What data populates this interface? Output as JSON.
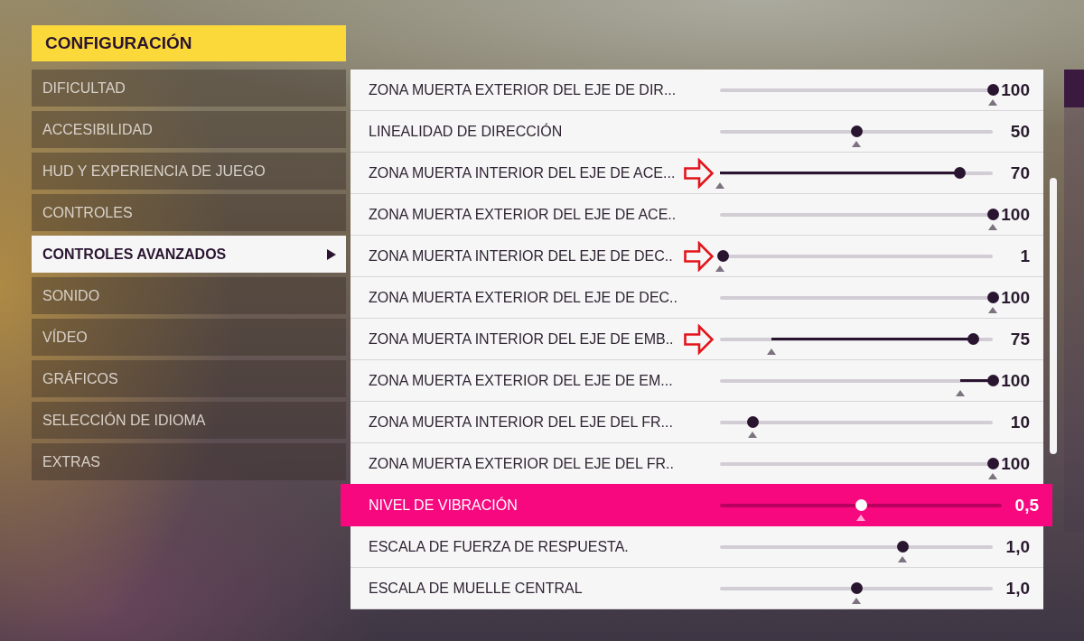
{
  "title": "CONFIGURACIÓN",
  "menu": [
    {
      "label": "DIFICULTAD",
      "selected": false
    },
    {
      "label": "ACCESIBILIDAD",
      "selected": false
    },
    {
      "label": "HUD Y EXPERIENCIA DE JUEGO",
      "selected": false
    },
    {
      "label": "CONTROLES",
      "selected": false
    },
    {
      "label": "CONTROLES AVANZADOS",
      "selected": true
    },
    {
      "label": "SONIDO",
      "selected": false
    },
    {
      "label": "VÍDEO",
      "selected": false
    },
    {
      "label": "GRÁFICOS",
      "selected": false
    },
    {
      "label": "SELECCIÓN DE IDIOMA",
      "selected": false
    },
    {
      "label": "EXTRAS",
      "selected": false
    }
  ],
  "settings": [
    {
      "label": "ZONA MUERTA EXTERIOR DEL EJE DE DIR...",
      "value": "100",
      "level": 1,
      "marker": {
        "level": 1
      },
      "selected": false,
      "annotation_arrow": false
    },
    {
      "label": "LINEALIDAD DE DIRECCIÓN",
      "value": "50",
      "level": 0.5,
      "marker": {
        "level": 0.5
      },
      "selected": false,
      "annotation_arrow": false
    },
    {
      "label": "ZONA MUERTA INTERIOR DEL EJE DE ACE...",
      "value": "70",
      "level": 0.88,
      "marker": {
        "level": 0
      },
      "selected": false,
      "annotation_arrow": true
    },
    {
      "label": "ZONA MUERTA EXTERIOR DEL EJE DE ACE..",
      "value": "100",
      "level": 1,
      "marker": {
        "level": 1
      },
      "selected": false,
      "annotation_arrow": false
    },
    {
      "label": "ZONA MUERTA INTERIOR DEL EJE DE DEC..",
      "value": "1",
      "level": 0.01,
      "marker": {
        "level": 0
      },
      "selected": false,
      "annotation_arrow": true
    },
    {
      "label": "ZONA MUERTA EXTERIOR DEL EJE DE DEC..",
      "value": "100",
      "level": 1,
      "marker": {
        "level": 1
      },
      "selected": false,
      "annotation_arrow": false
    },
    {
      "label": "ZONA MUERTA INTERIOR DEL EJE DE EMB..",
      "value": "75",
      "level": 0.93,
      "marker": {
        "level": 0.19
      },
      "selected": false,
      "annotation_arrow": true
    },
    {
      "label": "ZONA MUERTA EXTERIOR DEL EJE DE EM...",
      "value": "100",
      "level": 1,
      "marker": {
        "level": 0.88
      },
      "selected": false,
      "annotation_arrow": false
    },
    {
      "label": "ZONA MUERTA INTERIOR DEL EJE DEL FR...",
      "value": "10",
      "level": 0.12,
      "marker": {
        "level": 0.12
      },
      "selected": false,
      "annotation_arrow": false
    },
    {
      "label": "ZONA MUERTA EXTERIOR DEL EJE DEL FR..",
      "value": "100",
      "level": 1,
      "marker": {
        "level": 1
      },
      "selected": false,
      "annotation_arrow": false
    },
    {
      "label": "NIVEL DE VIBRACIÓN",
      "value": "0,5",
      "level": 0.5,
      "marker": {
        "level": 0.5
      },
      "selected": true,
      "annotation_arrow": false
    },
    {
      "label": "ESCALA DE FUERZA DE RESPUESTA.",
      "value": "1,0",
      "level": 0.67,
      "marker": {
        "level": 0.67
      },
      "selected": false,
      "annotation_arrow": false
    },
    {
      "label": "ESCALA DE MUELLE CENTRAL",
      "value": "1,0",
      "level": 0.5,
      "marker": {
        "level": 0.5
      },
      "selected": false,
      "annotation_arrow": false
    }
  ]
}
